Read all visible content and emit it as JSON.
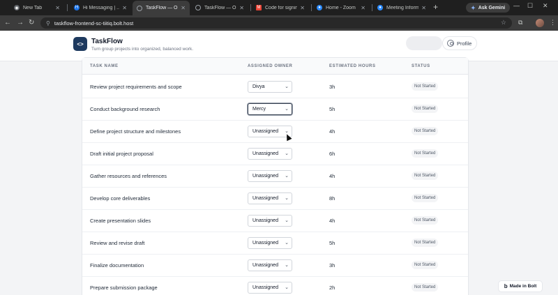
{
  "browser": {
    "tabs": [
      {
        "title": "New Tab",
        "favicon_color": "#8ab4f8"
      },
      {
        "title": "Hi Messaging | ...",
        "favicon_color": "#5f6368"
      },
      {
        "title": "TaskFlow — Org...",
        "favicon_color": "#9aa0a6"
      },
      {
        "title": "TaskFlow — Org...",
        "favicon_color": "#9aa0a6"
      },
      {
        "title": "Code for signing...",
        "favicon_color": "#ea4335"
      },
      {
        "title": "Home - Zoom",
        "favicon_color": "#2d8cff"
      },
      {
        "title": "Meeting Informa...",
        "favicon_color": "#2d8cff"
      }
    ],
    "new_tab": "+",
    "gemini_label": "Ask Gemini",
    "url": "taskflow-frontend-sc-tiitiq.bolt.host"
  },
  "header": {
    "logo_glyph": "<>",
    "title": "TaskFlow",
    "subtitle": "Turn group projects into organized, balanced work.",
    "profile_label": "Profile"
  },
  "table": {
    "columns": [
      "Task Name",
      "Assigned Owner",
      "Estimated Hours",
      "Status"
    ],
    "rows": [
      {
        "task": "Review project requirements and scope",
        "owner": "Divya",
        "hours": "3h",
        "status": "Not Started"
      },
      {
        "task": "Conduct background research",
        "owner": "Mercy",
        "hours": "5h",
        "status": "Not Started"
      },
      {
        "task": "Define project structure and milestones",
        "owner": "Unassigned",
        "hours": "4h",
        "status": "Not Started"
      },
      {
        "task": "Draft initial project proposal",
        "owner": "Unassigned",
        "hours": "6h",
        "status": "Not Started"
      },
      {
        "task": "Gather resources and references",
        "owner": "Unassigned",
        "hours": "4h",
        "status": "Not Started"
      },
      {
        "task": "Develop core deliverables",
        "owner": "Unassigned",
        "hours": "8h",
        "status": "Not Started"
      },
      {
        "task": "Create presentation slides",
        "owner": "Unassigned",
        "hours": "4h",
        "status": "Not Started"
      },
      {
        "task": "Review and revise draft",
        "owner": "Unassigned",
        "hours": "5h",
        "status": "Not Started"
      },
      {
        "task": "Finalize documentation",
        "owner": "Unassigned",
        "hours": "3h",
        "status": "Not Started"
      },
      {
        "task": "Prepare submission package",
        "owner": "Unassigned",
        "hours": "2h",
        "status": "Not Started"
      }
    ]
  },
  "bolt_badge": {
    "label": "Made in Bolt",
    "glyph": "b"
  }
}
